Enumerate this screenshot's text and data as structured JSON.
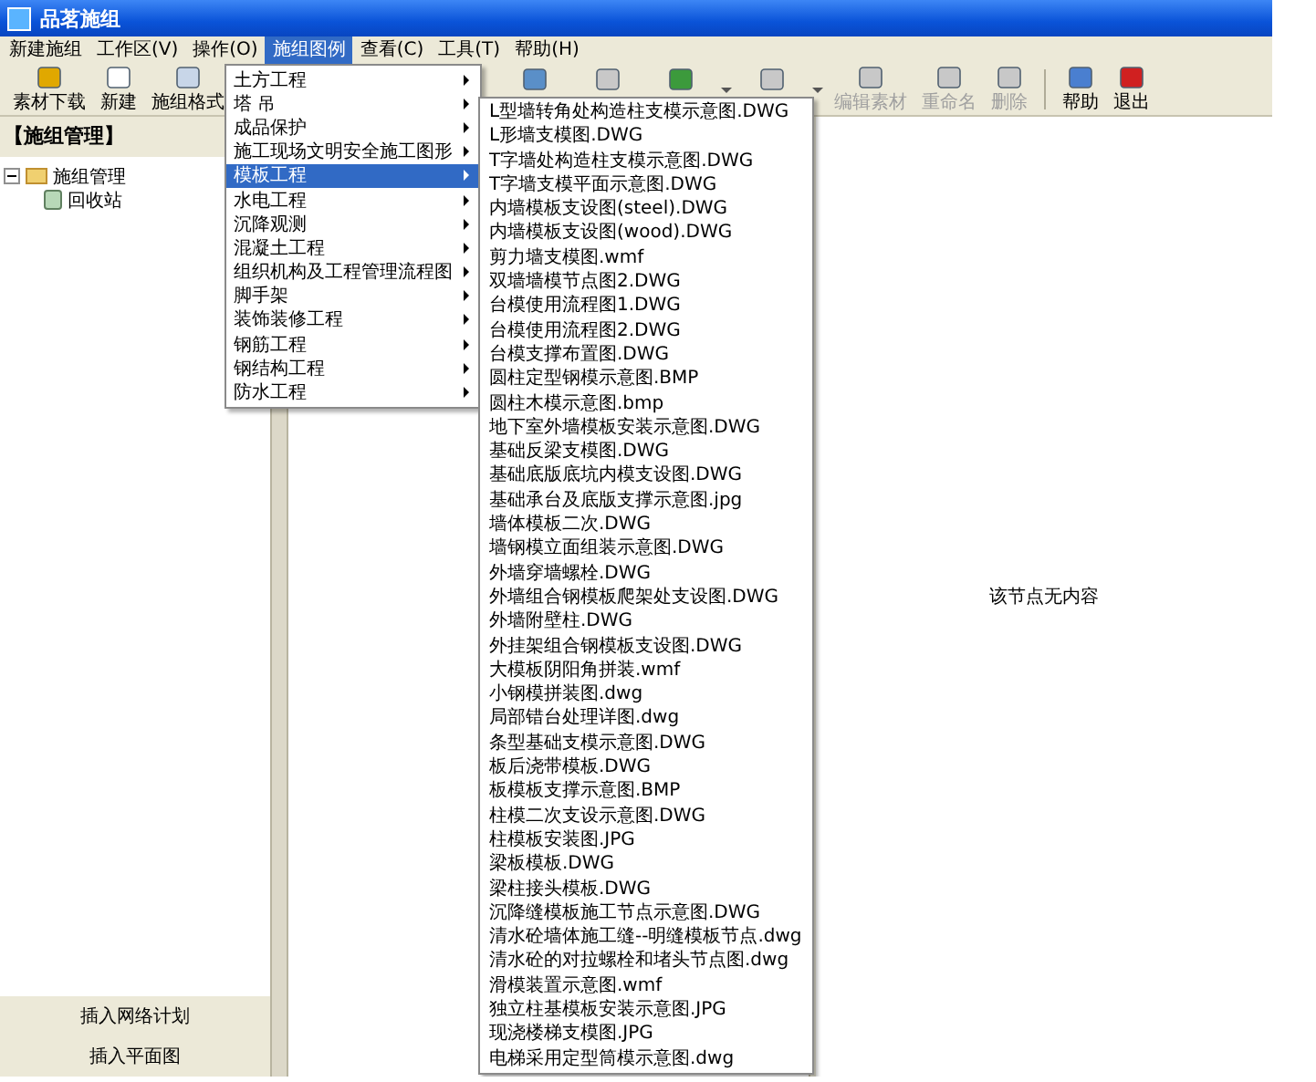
{
  "window": {
    "title": "品茗施组"
  },
  "menu": [
    {
      "label": "新建施组",
      "selected": false
    },
    {
      "label": "工作区(V)",
      "selected": false
    },
    {
      "label": "操作(O)",
      "selected": false
    },
    {
      "label": "施组图例",
      "selected": true
    },
    {
      "label": "查看(C)",
      "selected": false
    },
    {
      "label": "工具(T)",
      "selected": false
    },
    {
      "label": "帮助(H)",
      "selected": false
    }
  ],
  "toolbar": [
    {
      "label": "素材下载",
      "disabled": false
    },
    {
      "label": "新建",
      "disabled": false
    },
    {
      "label": "施组格式",
      "disabled": false
    },
    {
      "disabled": false
    },
    {
      "disabled": true
    },
    {
      "disabled": false,
      "dropdown": true
    },
    {
      "disabled": true,
      "dropdown": true
    },
    {
      "label": "编辑素材",
      "disabled": true
    },
    {
      "label": "重命名",
      "disabled": true
    },
    {
      "label": "删除",
      "disabled": true
    },
    {
      "label": "帮助",
      "disabled": false
    },
    {
      "label": "退出",
      "disabled": false
    }
  ],
  "left_panel": {
    "title": "【施组管理】",
    "tree": [
      {
        "label": "施组管理",
        "expanded": true,
        "children": [
          {
            "label": "回收站"
          }
        ]
      }
    ],
    "buttons": [
      "插入网络计划",
      "插入平面图"
    ]
  },
  "content": {
    "message": "该节点无内容"
  },
  "dropdown": [
    {
      "label": "土方工程",
      "selected": false
    },
    {
      "label": "塔 吊",
      "selected": false
    },
    {
      "label": "成品保护",
      "selected": false
    },
    {
      "label": "施工现场文明安全施工图形",
      "selected": false
    },
    {
      "label": "模板工程",
      "selected": true
    },
    {
      "label": "水电工程",
      "selected": false
    },
    {
      "label": "沉降观测",
      "selected": false
    },
    {
      "label": "混凝土工程",
      "selected": false
    },
    {
      "label": "组织机构及工程管理流程图",
      "selected": false
    },
    {
      "label": "脚手架",
      "selected": false
    },
    {
      "label": "装饰装修工程",
      "selected": false
    },
    {
      "label": "钢筋工程",
      "selected": false
    },
    {
      "label": "钢结构工程",
      "selected": false
    },
    {
      "label": "防水工程",
      "selected": false
    }
  ],
  "submenu": [
    "L型墙转角处构造柱支模示意图.DWG",
    "L形墙支模图.DWG",
    "T字墙处构造柱支模示意图.DWG",
    "T字墙支模平面示意图.DWG",
    "内墙模板支设图(steel).DWG",
    "内墙模板支设图(wood).DWG",
    "剪力墙支模图.wmf",
    "双墙墙模节点图2.DWG",
    "台模使用流程图1.DWG",
    "台模使用流程图2.DWG",
    "台模支撑布置图.DWG",
    "圆柱定型钢模示意图.BMP",
    "圆柱木模示意图.bmp",
    "地下室外墙模板安装示意图.DWG",
    "基础反梁支模图.DWG",
    "基础底版底坑内模支设图.DWG",
    "基础承台及底版支撑示意图.jpg",
    "墙体模板二次.DWG",
    "墙钢模立面组装示意图.DWG",
    "外墙穿墙螺栓.DWG",
    "外墙组合钢模板爬架处支设图.DWG",
    "外墙附壁柱.DWG",
    "外挂架组合钢模板支设图.DWG",
    "大模板阴阳角拼装.wmf",
    "小钢模拼装图.dwg",
    "局部错台处理详图.dwg",
    "条型基础支模示意图.DWG",
    "板后浇带模板.DWG",
    "板模板支撑示意图.BMP",
    "柱模二次支设示意图.DWG",
    "柱模板安装图.JPG",
    "梁板模板.DWG",
    "梁柱接头模板.DWG",
    "沉降缝模板施工节点示意图.DWG",
    "清水砼墙体施工缝--明缝模板节点.dwg",
    "清水砼的对拉螺栓和堵头节点图.dwg",
    "滑模装置示意图.wmf",
    "独立柱基模板安装示意图.JPG",
    "现浇楼梯支模图.JPG",
    "电梯采用定型筒模示意图.dwg"
  ]
}
